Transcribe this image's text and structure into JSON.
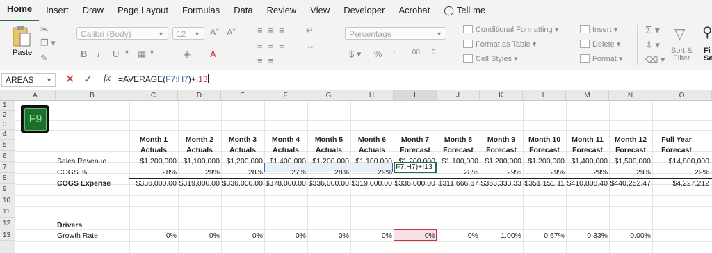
{
  "ribbon_tabs": [
    "Home",
    "Insert",
    "Draw",
    "Page Layout",
    "Formulas",
    "Data",
    "Review",
    "View",
    "Developer",
    "Acrobat",
    "Tell me"
  ],
  "ribbon": {
    "paste_label": "Paste",
    "font_name": "Calibri (Body)",
    "font_size": "12",
    "number_format": "Percentage",
    "conditional_formatting": "Conditional Formatting",
    "format_as_table": "Format as Table",
    "cell_styles": "Cell Styles",
    "insert": "Insert",
    "delete": "Delete",
    "format": "Format",
    "sort_filter_1": "Sort &",
    "sort_filter_2": "Filter",
    "find_1": "Fi",
    "find_2": "Se"
  },
  "formula_bar": {
    "name_box": "AREAS",
    "prefix": "=AVERAGE(",
    "ref1": "F7:H7",
    "mid": ")+",
    "ref2": "I13"
  },
  "columns": [
    "A",
    "B",
    "C",
    "D",
    "E",
    "F",
    "G",
    "H",
    "I",
    "J",
    "K",
    "L",
    "M",
    "N",
    "O"
  ],
  "rows": [
    "1",
    "2",
    "3",
    "4",
    "5",
    "6",
    "7",
    "8",
    "9",
    "10",
    "11",
    "12",
    "13"
  ],
  "logo_text": "F9",
  "header_top": [
    "Month 1",
    "Month 2",
    "Month 3",
    "Month 4",
    "Month 5",
    "Month 6",
    "Month 7",
    "Month 8",
    "Month 9",
    "Month 10",
    "Month 11",
    "Month 12",
    "Full Year"
  ],
  "header_bottom": [
    "Actuals",
    "Actuals",
    "Actuals",
    "Actuals",
    "Actuals",
    "Actuals",
    "Forecast",
    "Forecast",
    "Forecast",
    "Forecast",
    "Forecast",
    "Forecast",
    "Forecast"
  ],
  "sales": {
    "label": "Sales Revenue",
    "values": [
      "$1,200,000",
      "$1,100,000",
      "$1,200,000",
      "$1,400,000",
      "$1,200,000",
      "$1,100,000",
      "$1,200,000",
      "$1,100,000",
      "$1,200,000",
      "$1,200,000",
      "$1,400,000",
      "$1,500,000",
      "$14,800,000"
    ]
  },
  "cogs_pct": {
    "label": "COGS %",
    "values": [
      "28%",
      "29%",
      "28%",
      "27%",
      "28%",
      "29%",
      "F7:H7)+I13",
      "28%",
      "29%",
      "29%",
      "29%",
      "29%",
      "29%"
    ]
  },
  "cogs_exp": {
    "label": "COGS Expense",
    "values": [
      "$336,000.00",
      "$319,000.00",
      "$336,000.00",
      "$378,000.00",
      "$336,000.00",
      "$319,000.00",
      "$336,000.00",
      "$311,666.67",
      "$353,333.33",
      "$351,151.11",
      "$410,808.40",
      "$440,252.47",
      "$4,227,212"
    ]
  },
  "drivers_label": "Drivers",
  "growth": {
    "label": "Growth Rate",
    "values": [
      "0%",
      "0%",
      "0%",
      "0%",
      "0%",
      "0%",
      "0%",
      "0%",
      "1.00%",
      "0.67%",
      "0.33%",
      "0.00%"
    ]
  },
  "colors": {
    "accent": "#217346",
    "ref_blue": "#2f6db5",
    "ref_red": "#c8324a"
  }
}
